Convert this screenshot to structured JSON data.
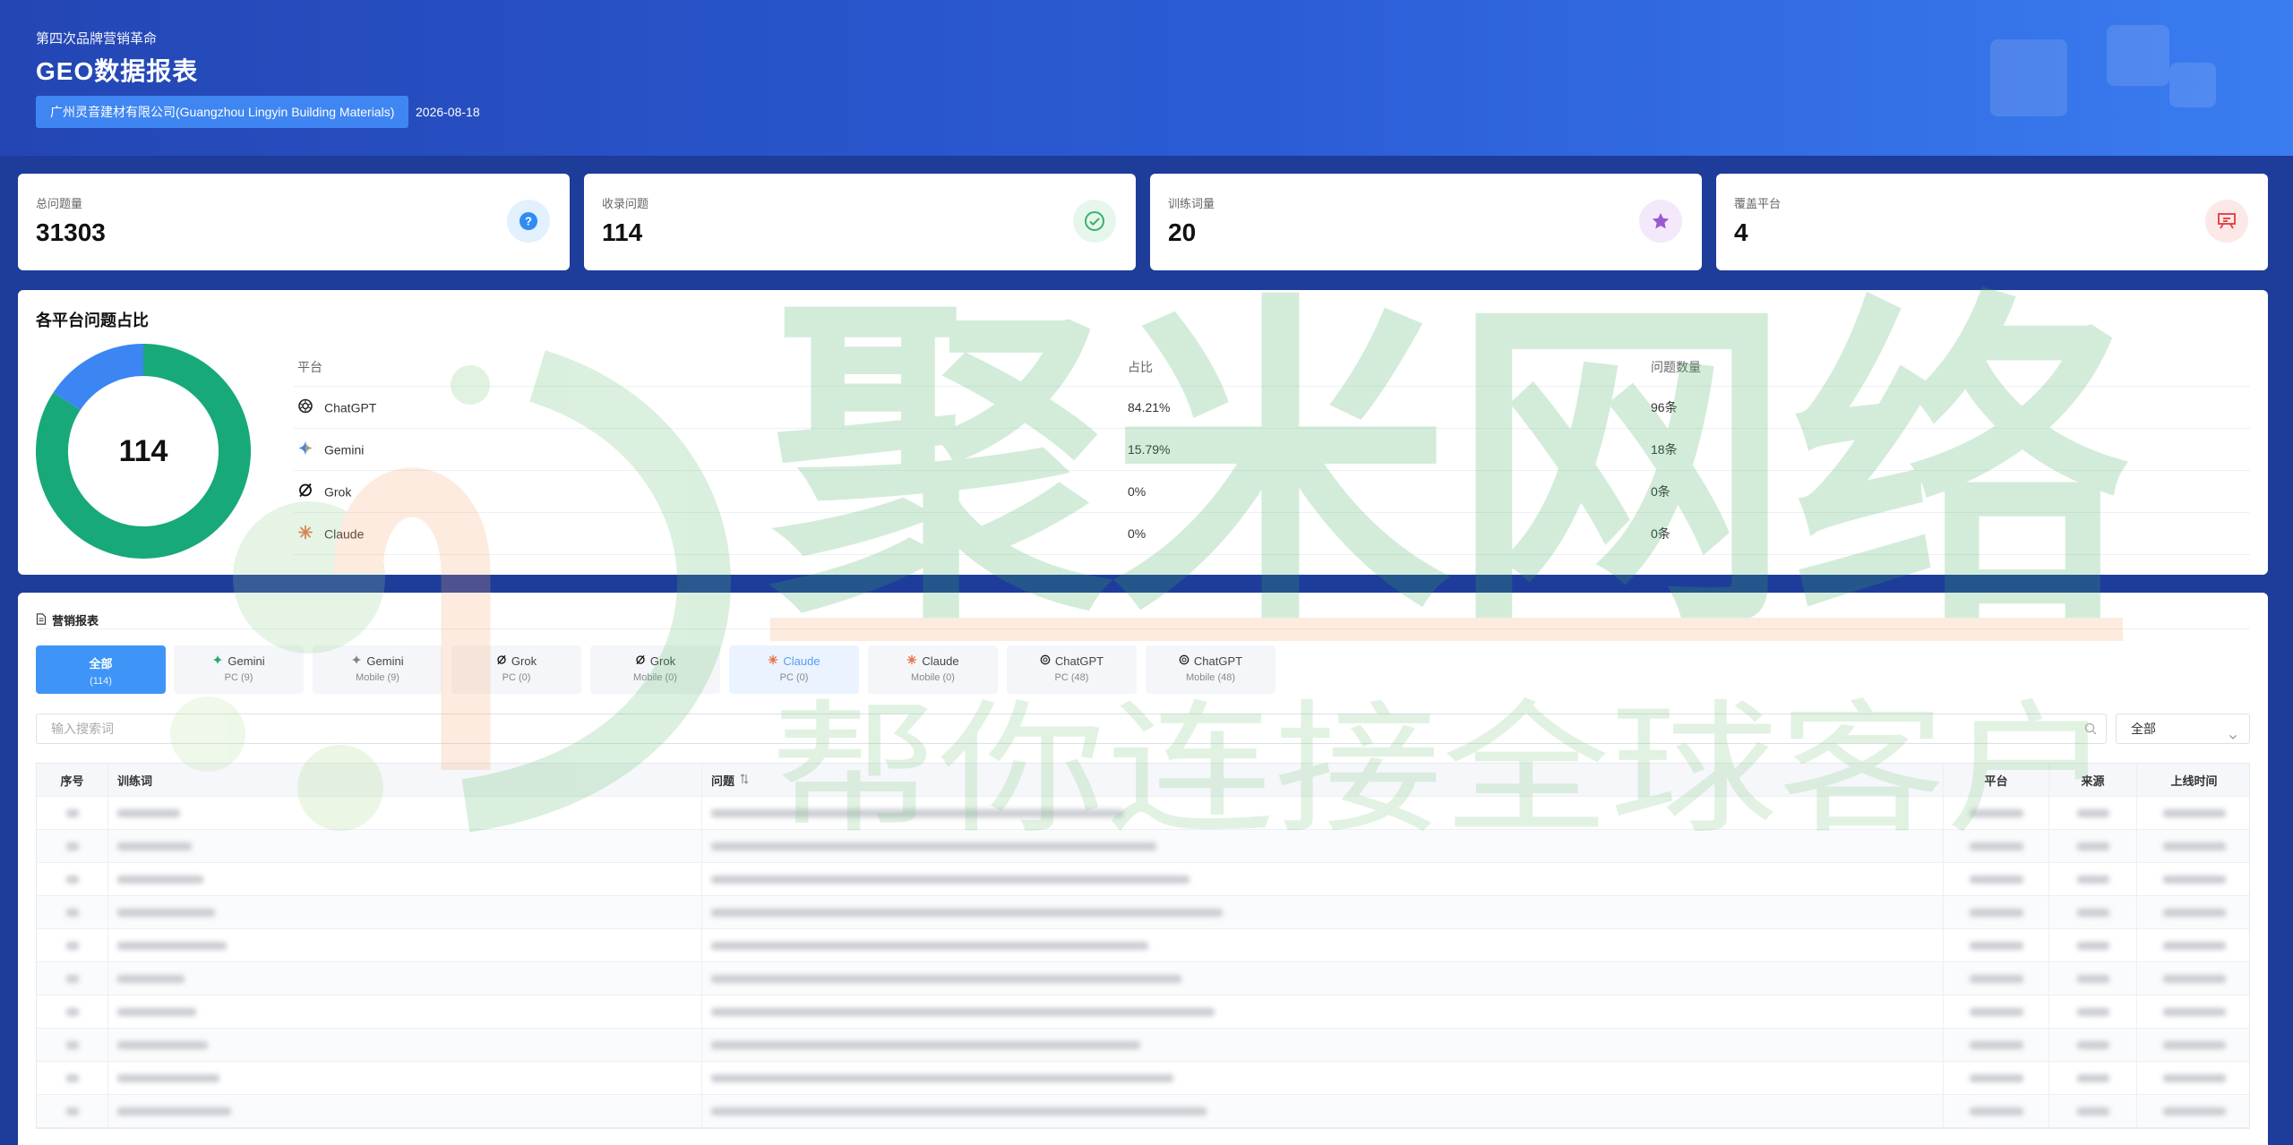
{
  "header": {
    "kicker": "第四次品牌营销革命",
    "title": "GEO数据报表",
    "company": "广州灵音建材有限公司(Guangzhou Lingyin Building Materials)",
    "date": "2026-08-18"
  },
  "stats": [
    {
      "label": "总问题量",
      "value": "31303",
      "icon": "question-icon",
      "color": "#2f8cf3"
    },
    {
      "label": "收录问题",
      "value": "114",
      "icon": "check-icon",
      "color": "#38b26a"
    },
    {
      "label": "训练词量",
      "value": "20",
      "icon": "star-icon",
      "color": "#9b59d0"
    },
    {
      "label": "覆盖平台",
      "value": "4",
      "icon": "presentation-icon",
      "color": "#e5484d"
    }
  ],
  "platforms": {
    "title": "各平台问题占比",
    "total": "114",
    "headers": {
      "platform": "平台",
      "share": "占比",
      "count": "问题数量"
    },
    "rows": [
      {
        "name": "ChatGPT",
        "share": "84.21%",
        "count": "96条",
        "icon": "chatgpt-icon"
      },
      {
        "name": "Gemini",
        "share": "15.79%",
        "count": "18条",
        "icon": "gemini-icon"
      },
      {
        "name": "Grok",
        "share": "0%",
        "count": "0条",
        "icon": "grok-icon"
      },
      {
        "name": "Claude",
        "share": "0%",
        "count": "0条",
        "icon": "claude-icon"
      }
    ],
    "chart_data": {
      "type": "pie",
      "categories": [
        "ChatGPT",
        "Gemini",
        "Grok",
        "Claude"
      ],
      "values": [
        96,
        18,
        0,
        0
      ],
      "colors": [
        "#17a97a",
        "#3b86f2",
        "#555555",
        "#e8734a"
      ]
    }
  },
  "report": {
    "title": "营销报表",
    "tabs": [
      {
        "label": "全部",
        "sub": "(114)",
        "icon": ""
      },
      {
        "label": "Gemini",
        "sub": "PC (9)",
        "icon": "gemini-icon"
      },
      {
        "label": "Gemini",
        "sub": "Mobile (9)",
        "icon": "gemini-icon"
      },
      {
        "label": "Grok",
        "sub": "PC (0)",
        "icon": "grok-icon"
      },
      {
        "label": "Grok",
        "sub": "Mobile (0)",
        "icon": "grok-icon"
      },
      {
        "label": "Claude",
        "sub": "PC (0)",
        "icon": "claude-icon"
      },
      {
        "label": "Claude",
        "sub": "Mobile (0)",
        "icon": "claude-icon"
      },
      {
        "label": "ChatGPT",
        "sub": "PC (48)",
        "icon": "chatgpt-icon"
      },
      {
        "label": "ChatGPT",
        "sub": "Mobile (48)",
        "icon": "chatgpt-icon"
      }
    ],
    "search_placeholder": "输入搜索词",
    "filter_value": "全部",
    "columns": {
      "idx": "序号",
      "keyword": "训练词",
      "question": "问题",
      "platform": "平台",
      "source": "来源",
      "time": "上线时间"
    }
  },
  "watermark": {
    "main": "聚米网络",
    "sub": "帮你连接全球客户"
  }
}
